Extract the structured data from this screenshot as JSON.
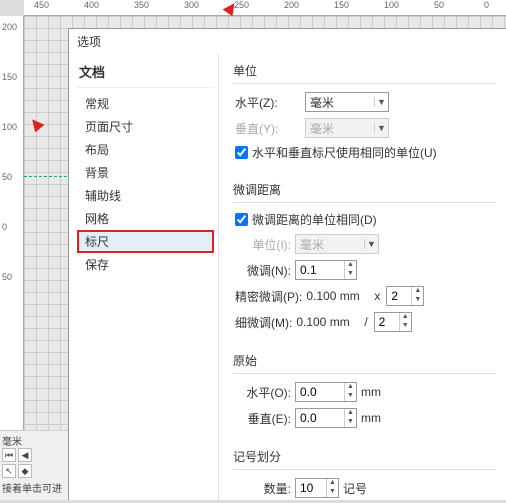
{
  "ruler_h": [
    "450",
    "400",
    "350",
    "300",
    "250",
    "200",
    "150",
    "100",
    "50",
    "0"
  ],
  "ruler_v": [
    "200",
    "150",
    "100",
    "50",
    "0",
    "50"
  ],
  "bottom_unit_label": "毫米",
  "status_text": "接着单击可进",
  "dialog": {
    "title": "选项",
    "nav_heading": "文档",
    "nav_items": [
      "常规",
      "页面尺寸",
      "布局",
      "背景",
      "辅助线",
      "网格",
      "标尺",
      "保存"
    ],
    "selected_index": 6
  },
  "units": {
    "group_title": "单位",
    "horiz_label": "水平(Z):",
    "horiz_value": "毫米",
    "vert_label": "垂直(Y):",
    "vert_value": "毫米",
    "same_checkbox_label": "水平和垂直标尺使用相同的单位(U)",
    "same_checked": true
  },
  "nudge": {
    "group_title": "微调距离",
    "same_checkbox_label": "微调距离的单位相同(D)",
    "same_checked": true,
    "unit_label": "单位(I):",
    "unit_value": "毫米",
    "nudge_label": "微调(N):",
    "nudge_value": "0.1",
    "super_label": "精密微调(P):",
    "super_display": "0.100 mm",
    "super_op": "x",
    "super_mult": "2",
    "micro_label": "细微调(M):",
    "micro_display": "0.100 mm",
    "micro_op": "/",
    "micro_div": "2"
  },
  "origin": {
    "group_title": "原始",
    "horiz_label": "水平(O):",
    "horiz_value": "0.0",
    "vert_label": "垂直(E):",
    "vert_value": "0.0",
    "unit": "mm"
  },
  "ticks": {
    "group_title": "记号划分",
    "count_label": "数量:",
    "count_value": "10",
    "suffix": "记号"
  }
}
